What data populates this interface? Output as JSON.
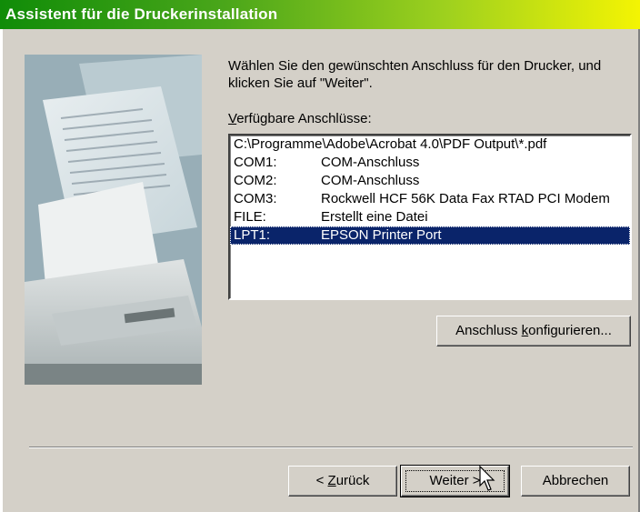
{
  "window": {
    "title": "Assistent für die Druckerinstallation"
  },
  "intro_text": "Wählen Sie den gewünschten Anschluss für den Drucker, und klicken Sie auf \"Weiter\".",
  "ports_label": {
    "mnemonic": "V",
    "rest": "erfügbare Anschlüsse:"
  },
  "ports": [
    {
      "full": "C:\\Programme\\Adobe\\Acrobat 4.0\\PDF Output\\*.pdf",
      "name": "",
      "desc": ""
    },
    {
      "full": "",
      "name": "COM1:",
      "desc": "COM-Anschluss"
    },
    {
      "full": "",
      "name": "COM2:",
      "desc": "COM-Anschluss"
    },
    {
      "full": "",
      "name": "COM3:",
      "desc": "Rockwell HCF 56K Data Fax RTAD PCI Modem"
    },
    {
      "full": "",
      "name": "FILE:",
      "desc": "Erstellt eine Datei"
    },
    {
      "full": "",
      "name": "LPT1:",
      "desc": "EPSON Printer Port"
    }
  ],
  "selected_port_index": 5,
  "buttons": {
    "configure": {
      "before": "Anschluss ",
      "mnemonic": "k",
      "after": "onfigurieren..."
    },
    "back": {
      "before": "< ",
      "mnemonic": "Z",
      "after": "urück"
    },
    "next": {
      "label": "Weiter >"
    },
    "cancel": {
      "label": "Abbrechen"
    }
  }
}
